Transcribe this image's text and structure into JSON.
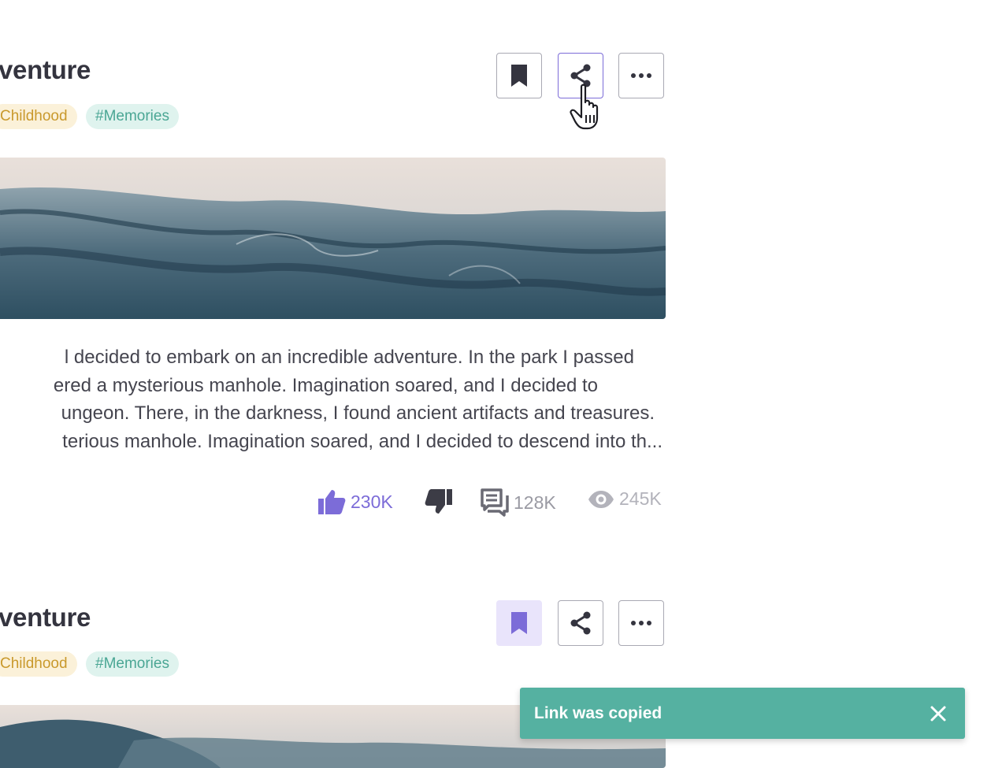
{
  "posts": [
    {
      "title": "venture",
      "tags": [
        "Childhood",
        "#Memories"
      ],
      "excerpt": [
        "l decided to embark on an incredible adventure. In the park I passed",
        "ered a mysterious manhole. Imagination soared, and I decided to",
        "ungeon. There, in the darkness, I found ancient artifacts and treasures.",
        "terious manhole. Imagination soared, and I decided to descend into th..."
      ],
      "stats": {
        "likes": "230K",
        "comments": "128K",
        "views": "245K"
      },
      "bookmarked": false
    },
    {
      "title": "venture",
      "tags": [
        "Childhood",
        "#Memories"
      ],
      "bookmarked": true
    }
  ],
  "toast": {
    "message": "Link was copied"
  },
  "icons": {
    "bookmark": "bookmark-icon",
    "share": "share-icon",
    "more": "more-icon",
    "like": "thumbs-up-icon",
    "dislike": "thumbs-down-icon",
    "comments": "comments-icon",
    "views": "eye-icon",
    "close": "close-icon"
  },
  "colors": {
    "accent": "#7c6cd8",
    "toast": "#55b1a1",
    "tag_yellow_bg": "#fbf1d9",
    "tag_green_bg": "#dff3ee",
    "muted": "#9a9aa3"
  }
}
